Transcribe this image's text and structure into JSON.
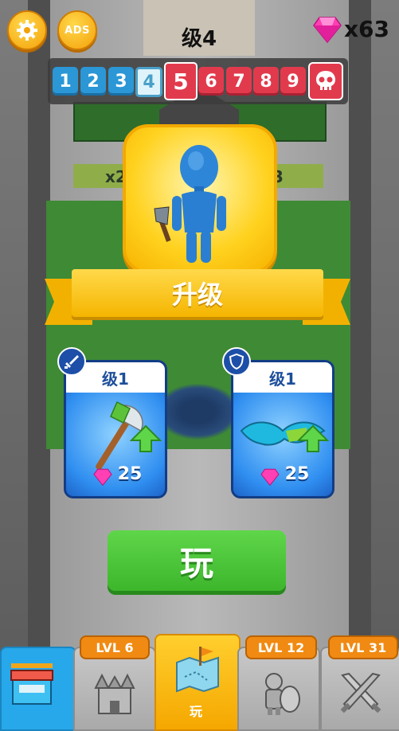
{
  "hud": {
    "level_title": "级4",
    "gem_count": "x63",
    "settings_icon": "gear-icon",
    "ads_button_label": "ADS"
  },
  "level_track": {
    "levels": [
      "1",
      "2",
      "3",
      "4",
      "5",
      "6",
      "7",
      "8",
      "9"
    ],
    "current": "4",
    "next": "5",
    "boss_icon": "skull-icon"
  },
  "scene": {
    "multiplier_left": "x2",
    "multiplier_right": "3"
  },
  "character": {
    "icon": "blue-warrior-axe-icon"
  },
  "upgrade_banner": {
    "label": "升级"
  },
  "cards": [
    {
      "type": "weapon",
      "badge_icon": "sword-icon",
      "level": "级1",
      "price": "25",
      "item_icon": "axe-icon",
      "arrow_icon": "upgrade-arrow-icon",
      "gem_icon": "gem-icon"
    },
    {
      "type": "armor",
      "badge_icon": "shield-icon",
      "level": "级1",
      "price": "25",
      "item_icon": "wings-icon",
      "arrow_icon": "upgrade-arrow-icon",
      "gem_icon": "gem-icon"
    }
  ],
  "play_button": {
    "label": "玩"
  },
  "bottom_nav": {
    "tabs": [
      {
        "name": "shop",
        "icon": "shop-icon",
        "lvl": ""
      },
      {
        "name": "castle",
        "icon": "castle-icon",
        "lvl": "LVL 6"
      },
      {
        "name": "play",
        "icon": "map-icon",
        "lvl": "",
        "label": "玩"
      },
      {
        "name": "knight",
        "icon": "knight-icon",
        "lvl": "LVL 12"
      },
      {
        "name": "battle",
        "icon": "crossed-swords-icon",
        "lvl": "LVL 31"
      }
    ]
  },
  "colors": {
    "blue_level": "#2b97d6",
    "red_level": "#e23a4d",
    "yellow": "#ffd21f",
    "green_button": "#4cc73a",
    "card_blue": "#2f8ef0"
  }
}
